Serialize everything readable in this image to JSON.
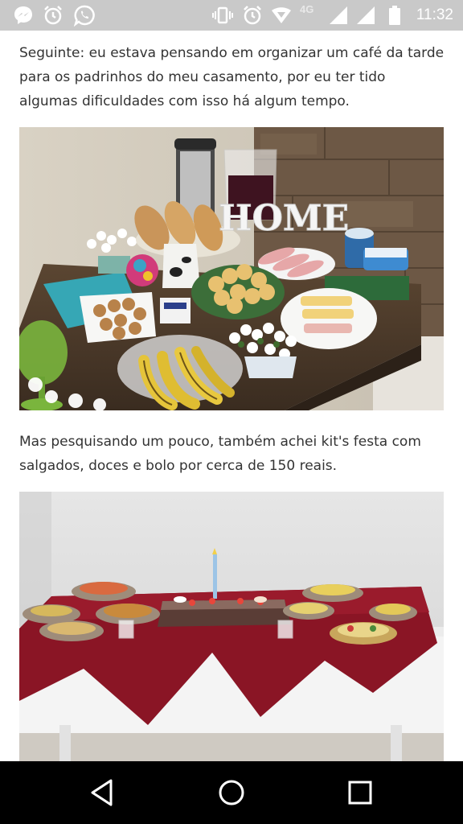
{
  "status_bar": {
    "time": "11:32",
    "network": "4G",
    "left_icons": [
      "messenger-icon",
      "alarm-icon",
      "whatsapp-icon"
    ],
    "right_icons": [
      "vibrate-icon",
      "alarm-icon",
      "wifi-icon",
      "signal-icon",
      "signal-icon",
      "battery-icon"
    ]
  },
  "article": {
    "paragraph_1": "Seguinte: eu estava pensando em organizar um café da tarde para os padrinhos do meu casamento, por eu ter tido algumas dificuldades com isso há algum tempo.",
    "photo_1": {
      "sign_text": "HOME"
    },
    "paragraph_2": "Mas pesquisando um pouco, também achei kit's festa com salgados, doces e bolo por cerca de 150 reais."
  },
  "nav_bar": {
    "buttons": [
      "back-icon",
      "home-icon",
      "recents-icon"
    ]
  },
  "colors": {
    "status_bar": "#c9c9c9",
    "text": "#333333",
    "nav_bar": "#000000",
    "tablecloth_red": "#8a1525"
  }
}
